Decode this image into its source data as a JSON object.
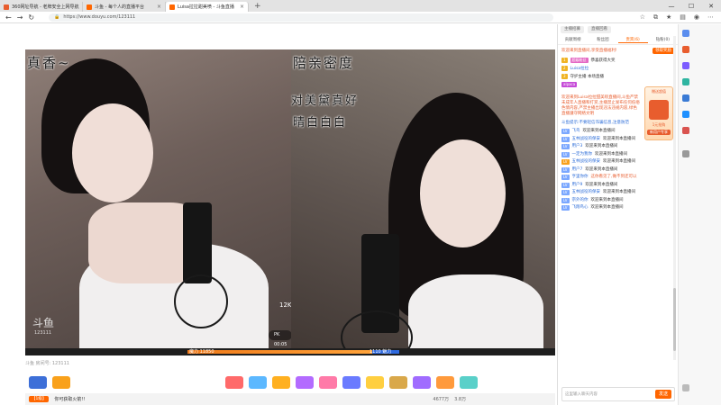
{
  "browser": {
    "tabs": [
      {
        "title": "360网址导航 - 老牌安全上网导航",
        "active": false
      },
      {
        "title": "斗鱼 - 每个人的直播平台",
        "active": false
      },
      {
        "title": "Luisa拉拉甜美喷 - 斗鱼直播",
        "active": true
      }
    ],
    "url": "https://www.douyu.com/123111"
  },
  "stream": {
    "caption_left": "真香~",
    "caption_right_1": "陪亲密度",
    "caption_right_2": "对美黛真好",
    "caption_right_3": "晴白白白",
    "mic_label_left": "12K",
    "watermark": "斗鱼",
    "watermark_id": "123111",
    "pk_left": "魔力 11850",
    "pk_timer": "PK 00:05",
    "pk_right": "1110 魅力",
    "room_info": "斗鱼 房间号: 123111"
  },
  "bottom": {
    "user_level": "【1级】",
    "user_text": "你可获取火箭!!",
    "stats": [
      "4677万",
      "3.8万"
    ]
  },
  "panel": {
    "top_btns": [
      "主播招募",
      "直播回看"
    ],
    "tabs": [
      "贡献周榜",
      "粉丝团",
      "贵宾(6)",
      "钻粉(0)"
    ],
    "tab_on": 2,
    "notice": "欢迎来到直播间,享受直播福利!",
    "notice_btn": "领取奖励",
    "rank": [
      {
        "name": "超级粉丝",
        "text": "恭喜获得大奖"
      },
      {
        "name": "Luisa拉拉",
        "text": ""
      },
      {
        "name": "VIP",
        "text": "守护主播 本场直播"
      },
      {
        "name": "alpaca",
        "text": ""
      }
    ],
    "promo_text": "赠送超值",
    "promo_btn": "1元抢购",
    "promo_sub": "新用户专享",
    "welcome": "欢迎来到Luisa拉拉甜美喷直播间,斗鱼严禁未成年人直播和打赏,主播禁止发布任何低俗色情内容,严禁主播出现违法违规内容,绿色直播遵守网络文明",
    "system": "斗鱼提示:不要轻信诈骗信息,注意防范",
    "messages": [
      {
        "badge": "LV",
        "user": "飞鸟",
        "text": "欢迎来到本直播间"
      },
      {
        "badge": "LV",
        "user": "五林战役的保安",
        "text": "欢迎来到本直播间"
      },
      {
        "badge": "LV",
        "user": "用户3",
        "text": "欢迎来到本直播间"
      },
      {
        "badge": "LV",
        "user": "一定为我你",
        "text": "欢迎来到本直播间"
      },
      {
        "badge": "LV",
        "user": "五林战役的保安",
        "text": "欢迎来到本直播间"
      },
      {
        "badge": "LV",
        "user": "用户7",
        "text": "欢迎来到本直播间"
      },
      {
        "badge": "LV",
        "user": "亨里你你",
        "text": "这你看见了,做不到还可以"
      },
      {
        "badge": "LV",
        "user": "用户9",
        "text": "欢迎来到本直播间"
      },
      {
        "badge": "LV",
        "user": "五林战役的保安",
        "text": "欢迎来到本直播间"
      },
      {
        "badge": "LV",
        "user": "宗外的你",
        "text": "欢迎来到本直播间"
      },
      {
        "badge": "LV",
        "user": "飞翔鸟心",
        "text": "欢迎来到本直播间"
      }
    ],
    "chat_placeholder": "这里输入聊天内容",
    "send_label": "发送"
  }
}
